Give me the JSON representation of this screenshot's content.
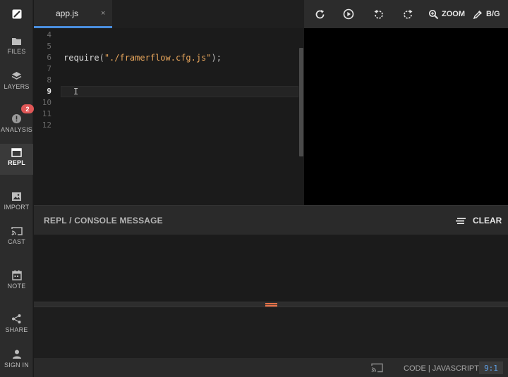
{
  "sidebar": {
    "items": [
      {
        "label": "FILES",
        "icon": "folder-icon"
      },
      {
        "label": "LAYERS",
        "icon": "layers-icon"
      },
      {
        "label": "ANALYSIS",
        "icon": "alert-circle-icon",
        "badge": "2"
      },
      {
        "label": "REPL",
        "icon": "window-icon"
      },
      {
        "label": "IMPORT",
        "icon": "image-icon"
      },
      {
        "label": "CAST",
        "icon": "cast-icon"
      },
      {
        "label": "NOTE",
        "icon": "calendar-icon"
      },
      {
        "label": "SHARE",
        "icon": "share-icon"
      },
      {
        "label": "SIGN IN",
        "icon": "user-icon"
      }
    ],
    "active": "REPL"
  },
  "editor": {
    "tab": {
      "name": "app.js",
      "close": "×"
    },
    "line_numbers": [
      "4",
      "5",
      "6",
      "7",
      "8",
      "9",
      "10",
      "11",
      "12"
    ],
    "current_line": "9",
    "code": {
      "fn": "require",
      "open": "(",
      "str": "\"./framerflow.cfg.js\"",
      "close": ");"
    }
  },
  "toolbar": {
    "buttons": [
      "refresh-icon",
      "play-icon",
      "rotate-left-icon",
      "rotate-right-icon"
    ],
    "zoom_label": "ZOOM",
    "bg_label": "B/G"
  },
  "console": {
    "title": "REPL / CONSOLE MESSAGE",
    "clear_label": "CLEAR"
  },
  "status": {
    "mode": "CODE | JAVASCRIPT",
    "position": "9:1"
  },
  "colors": {
    "accent": "#4a8ede",
    "badge": "#e05757",
    "string": "#e8a65c",
    "grip": "#e8734a"
  }
}
